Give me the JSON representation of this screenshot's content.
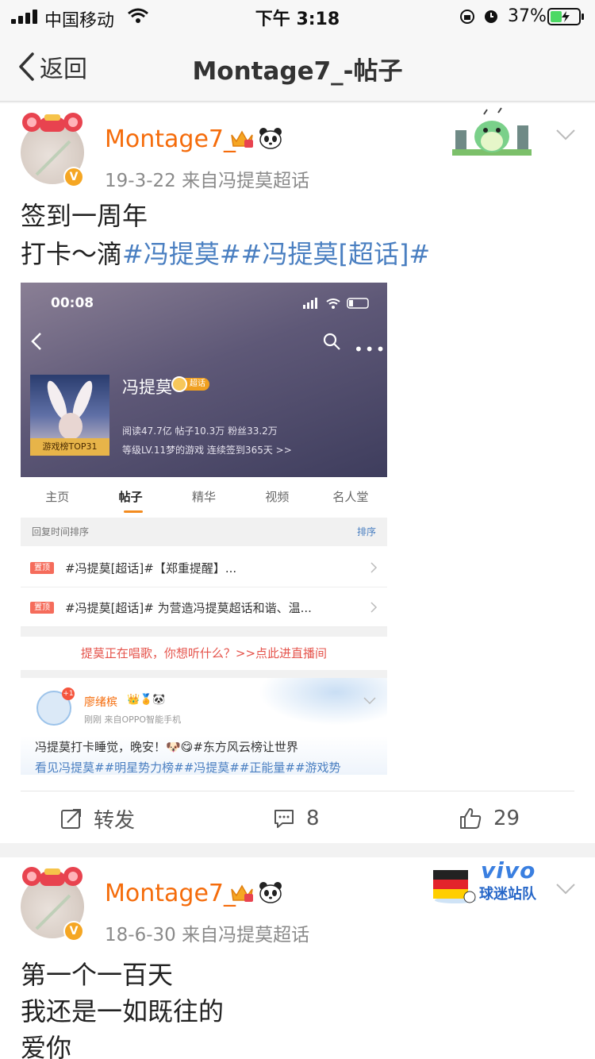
{
  "status_bar": {
    "carrier": "中国移动",
    "time": "下午 3:18",
    "battery_pct": "37%"
  },
  "nav": {
    "back_label": "返回",
    "title": "Montage7_-帖子"
  },
  "posts": [
    {
      "username": "Montage7_",
      "meta": "19-3-22  来自冯提莫超话",
      "text_line1": "签到一周年",
      "text_line2_plain": "打卡～滴",
      "text_line2_tags": "#冯提莫##冯提莫[超话]#",
      "embedded": {
        "time": "00:08",
        "name": "冯提莫",
        "level_badge": "超话",
        "rank_label": "游戏榜TOP31",
        "stats1": "阅读47.7亿   帖子10.3万   粉丝33.2万",
        "stats2": "等级LV.11梦的游戏   连续签到365天 >>",
        "tabs": [
          "主页",
          "帖子",
          "精华",
          "视频",
          "名人堂"
        ],
        "sort_label": "回复时间排序",
        "sort_action": "排序",
        "pinned_tag": "置顶",
        "pinned_rows": [
          "#冯提莫[超话]#【郑重提醒】...",
          "#冯提莫[超话]# 为营造冯提莫超话和谐、温..."
        ],
        "live_banner": "提莫正在唱歌，你想听什么？>>点此进直播间",
        "sub_post": {
          "badge_count": "+1",
          "username": "廖绪槟",
          "meta": "刚刚  来自OPPO智能手机",
          "line1": "冯提莫打卡睡觉，晚安！🐶😋#东方风云榜让世界",
          "line2": "看见冯提莫##明星势力榜##冯提莫##正能量##游戏势"
        }
      },
      "actions": {
        "repost_label": "转发",
        "comment_count": "8",
        "like_count": "29"
      }
    },
    {
      "username": "Montage7_",
      "meta": "18-6-30  来自冯提莫超话",
      "line1": "第一个一百天",
      "line2": "我还是一如既往的",
      "line3": "爱你",
      "badge_text_top": "vivo",
      "badge_text_bottom": "球迷站队"
    }
  ],
  "colors": {
    "username": "#f56c0b",
    "topic_link": "#4a7fc1",
    "meta_gray": "#8a8a8a",
    "verified_badge": "#f5a623"
  }
}
